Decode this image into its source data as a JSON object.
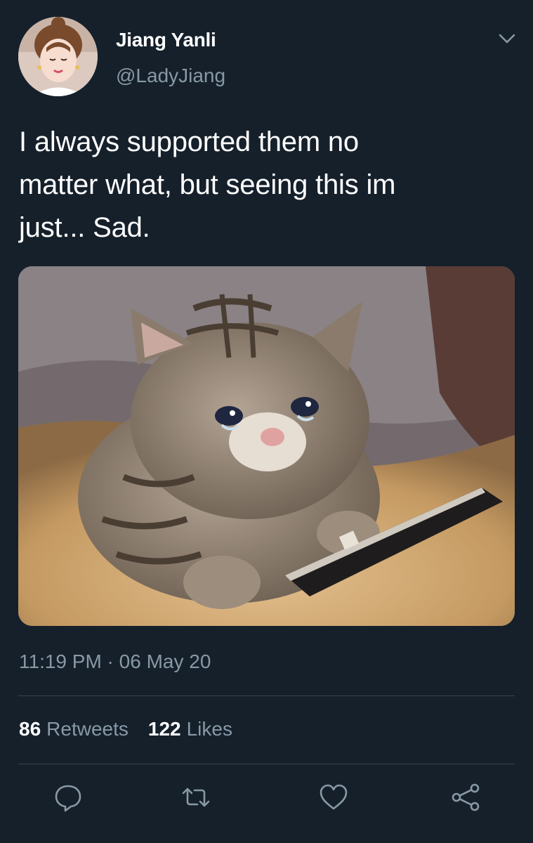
{
  "author": {
    "display_name": "Jiang Yanli",
    "handle": "@LadyJiang"
  },
  "tweet": {
    "text_lines": [
      "I always supported them no",
      "matter what, but seeing this im",
      "just... Sad."
    ],
    "timestamp": "11:19 PM · 06 May 20"
  },
  "stats": {
    "retweets_count": "86",
    "retweets_label": "Retweets",
    "likes_count": "122",
    "likes_label": "Likes"
  },
  "actions": {
    "reply_icon": "reply-icon",
    "retweet_icon": "retweet-icon",
    "like_icon": "heart-icon",
    "share_icon": "share-icon"
  },
  "colors": {
    "background": "#15202b",
    "text_primary": "#ffffff",
    "text_secondary": "#8899a6",
    "divider": "#38444d"
  }
}
